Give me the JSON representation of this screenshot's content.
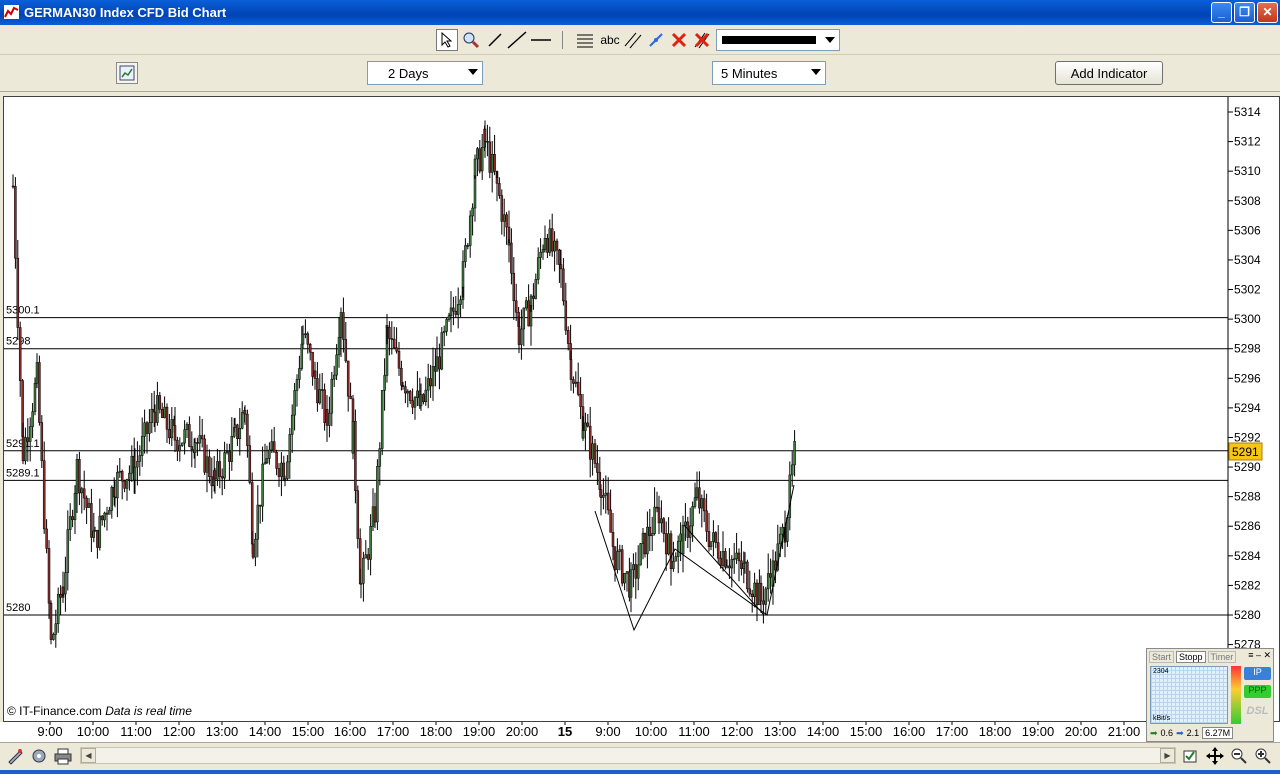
{
  "window": {
    "title": "GERMAN30 Index CFD Bid Chart"
  },
  "toolbar": {
    "text_tool_label": "abc",
    "icons": [
      "pointer-icon",
      "zoom-icon",
      "line-icon",
      "trendline-icon",
      "horizontal-line-icon",
      "fibonacci-icon",
      "text-icon",
      "channel-icon",
      "crosshair-icon",
      "delete-icon",
      "delete-all-icon"
    ],
    "line_color": "#000000"
  },
  "controls": {
    "period": "2 Days",
    "interval": "5 Minutes",
    "add_indicator_label": "Add Indicator"
  },
  "chart_data": {
    "type": "candlestick",
    "y_ticks": [
      "5314",
      "5312",
      "5310",
      "5308",
      "5306",
      "5304",
      "5302",
      "5300",
      "5298",
      "5296",
      "5294",
      "5292",
      "5290",
      "5288",
      "5286",
      "5284",
      "5282",
      "5280",
      "5278"
    ],
    "ylim": [
      5277,
      5315
    ],
    "x_ticks": [
      "9:00",
      "10:00",
      "11:00",
      "12:00",
      "13:00",
      "14:00",
      "15:00",
      "16:00",
      "17:00",
      "18:00",
      "19:00",
      "20:00",
      "15",
      "9:00",
      "10:00",
      "11:00",
      "12:00",
      "13:00",
      "14:00",
      "15:00",
      "16:00",
      "17:00",
      "18:00",
      "19:00",
      "20:00",
      "21:00"
    ],
    "current_price": "5291",
    "horizontal_lines": [
      {
        "label": "5300.1",
        "value": 5300.1
      },
      {
        "label": "5298",
        "value": 5298
      },
      {
        "label": "5291.1",
        "value": 5291.1
      },
      {
        "label": "5289.1",
        "value": 5289.1
      },
      {
        "label": "5280",
        "value": 5280
      }
    ],
    "watermark_source": "© IT-Finance.com",
    "watermark_note": "Data is real time",
    "colors": {
      "up": "#3d7a3d",
      "down": "#8b2a2a",
      "current_price_bg": "#f5c518"
    }
  },
  "meter": {
    "tabs": [
      "Start",
      "Stopp",
      "Timer"
    ],
    "value_label": "2304",
    "unit_label": "kBit/s",
    "down_speed": "0.6",
    "up_speed": "2.1",
    "total": "6.27M",
    "buttons": [
      "IP",
      "PPP",
      "DSL"
    ]
  }
}
